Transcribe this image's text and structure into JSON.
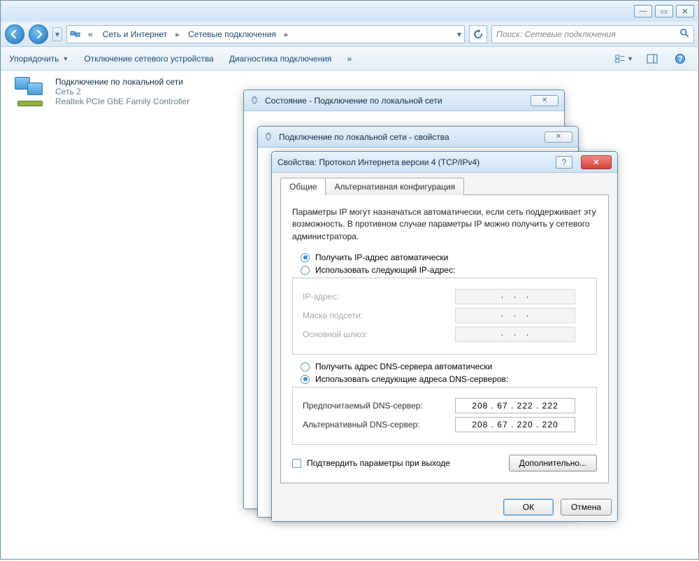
{
  "window": {
    "min_glyph": "—",
    "max_glyph": "▭",
    "close_glyph": "✕"
  },
  "breadcrumb": {
    "prefix": "«",
    "item1": "Сеть и Интернет",
    "item2": "Сетевые подключения",
    "sep": "▸"
  },
  "search": {
    "placeholder": "Поиск: Сетевые подключения"
  },
  "toolbar": {
    "organize": "Упорядочить",
    "disable": "Отключение сетевого устройства",
    "diagnose": "Диагностика подключения",
    "more": "»"
  },
  "connection": {
    "name": "Подключение по локальной сети",
    "network": "Сеть  2",
    "adapter": "Realtek PCIe GbE Family Controller"
  },
  "dlg_state": {
    "title": "Состояние - Подключение по локальной сети"
  },
  "dlg_props": {
    "title": "Подключение по локальной сети - свойства"
  },
  "ipv4": {
    "title": "Свойства: Протокол Интернета версии 4 (TCP/IPv4)",
    "tab_general": "Общие",
    "tab_alt": "Альтернативная конфигурация",
    "info": "Параметры IP могут назначаться автоматически, если сеть поддерживает эту возможность. В противном случае параметры IP можно получить у сетевого администратора.",
    "ip_auto": "Получить IP-адрес автоматически",
    "ip_manual": "Использовать следующий IP-адрес:",
    "ip_addr_lbl": "IP-адрес:",
    "mask_lbl": "Маска подсети:",
    "gw_lbl": "Основной шлюз:",
    "dns_auto": "Получить адрес DNS-сервера автоматически",
    "dns_manual": "Использовать следующие адреса DNS-серверов:",
    "dns_pref_lbl": "Предпочитаемый DNS-сервер:",
    "dns_alt_lbl": "Альтернативный DNS-сервер:",
    "dns_pref_val": "208 .  67  . 222 . 222",
    "dns_alt_val": "208 .  67  . 220 . 220",
    "validate": "Подтвердить параметры при выходе",
    "advanced": "Дополнительно...",
    "ok": "ОК",
    "cancel": "Отмена",
    "help_glyph": "?",
    "close_glyph": "✕"
  }
}
